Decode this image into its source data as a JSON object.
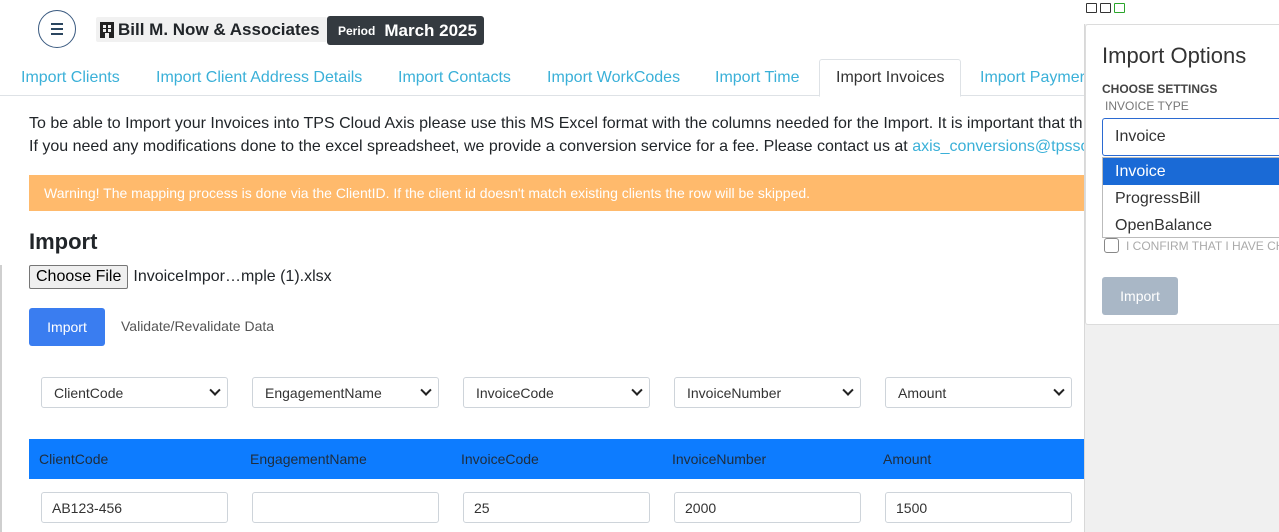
{
  "header": {
    "company_name": "Bill M. Now & Associates",
    "period_label": "Period",
    "period_value": "March 2025"
  },
  "tabs": [
    {
      "label": "Import Clients"
    },
    {
      "label": "Import Client Address Details"
    },
    {
      "label": "Import Contacts"
    },
    {
      "label": "Import WorkCodes"
    },
    {
      "label": "Import Time"
    },
    {
      "label": "Import Invoices",
      "active": true
    },
    {
      "label": "Import Paymer"
    }
  ],
  "intro": {
    "line1": "To be able to Import your Invoices into TPS Cloud Axis please use this MS Excel format with the columns needed for the Import. It is important that th",
    "line2_prefix": "If you need any modifications done to the excel spreadsheet, we provide a conversion service for a fee. Please contact us at ",
    "line2_email": "axis_conversions@tpsso"
  },
  "warning": "Warning! The mapping process is done via the ClientID. If the client id doesn't match existing clients the row will be skipped.",
  "import_section": {
    "title": "Import",
    "choose_file_label": "Choose File",
    "file_name": "InvoiceImpor…mple (1).xlsx",
    "import_button": "Import",
    "validate_link": "Validate/Revalidate Data"
  },
  "mapping_selects": [
    "ClientCode",
    "EngagementName",
    "InvoiceCode",
    "InvoiceNumber",
    "Amount"
  ],
  "table": {
    "headers": [
      "ClientCode",
      "EngagementName",
      "InvoiceCode",
      "InvoiceNumber",
      "Amount"
    ],
    "row": [
      "AB123-456",
      "",
      "25",
      "2000",
      "1500"
    ]
  },
  "panel": {
    "title": "Import Options",
    "subtitle": "CHOOSE SETTINGS",
    "field_label": "INVOICE TYPE",
    "selected_value": "Invoice",
    "options": [
      "Invoice",
      "ProgressBill",
      "OpenBalance"
    ],
    "confirm_text": "I CONFIRM THAT I HAVE CHE",
    "import_button": "Import"
  }
}
